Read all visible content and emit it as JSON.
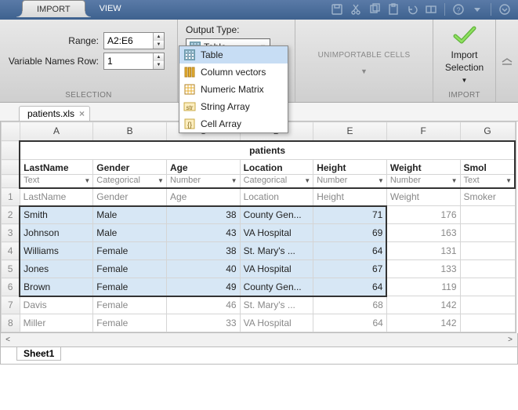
{
  "tabs": {
    "import": "IMPORT",
    "view": "VIEW"
  },
  "toolbar_icons": [
    "save",
    "cut",
    "copy",
    "paste",
    "undo",
    "redo",
    "help",
    "dropdown",
    "minimize"
  ],
  "selection": {
    "range_label": "Range:",
    "range_value": "A2:E6",
    "varnames_label": "Variable Names Row:",
    "varnames_value": "1",
    "group_label": "SELECTION"
  },
  "output": {
    "label": "Output Type:",
    "selected": "Table",
    "options": [
      {
        "label": "Table",
        "icon": "table-icon"
      },
      {
        "label": "Column vectors",
        "icon": "columns-icon"
      },
      {
        "label": "Numeric Matrix",
        "icon": "matrix-icon"
      },
      {
        "label": "String Array",
        "icon": "string-icon"
      },
      {
        "label": "Cell Array",
        "icon": "cell-icon"
      }
    ]
  },
  "unimportable": {
    "label": "UNIMPORTABLE CELLS"
  },
  "import": {
    "line1": "Import",
    "line2": "Selection",
    "group_label": "IMPORT"
  },
  "file": {
    "name": "patients.xls"
  },
  "columns": [
    "A",
    "B",
    "C",
    "D",
    "E",
    "F",
    "G"
  ],
  "table_name": "patients",
  "fields": [
    {
      "name": "LastName",
      "type": "Text"
    },
    {
      "name": "Gender",
      "type": "Categorical"
    },
    {
      "name": "Age",
      "type": "Number"
    },
    {
      "name": "Location",
      "type": "Categorical"
    },
    {
      "name": "Height",
      "type": "Number"
    },
    {
      "name": "Weight",
      "type": "Number"
    },
    {
      "name": "Smoker",
      "short": "Smol",
      "type": "Text"
    }
  ],
  "rows": [
    {
      "n": 1,
      "sel": false,
      "c": [
        "LastName",
        "Gender",
        "Age",
        "Location",
        "Height",
        "Weight",
        "Smoker"
      ]
    },
    {
      "n": 2,
      "sel": true,
      "c": [
        "Smith",
        "Male",
        "38",
        "County Gen...",
        "71",
        "176",
        ""
      ]
    },
    {
      "n": 3,
      "sel": true,
      "c": [
        "Johnson",
        "Male",
        "43",
        "VA Hospital",
        "69",
        "163",
        ""
      ]
    },
    {
      "n": 4,
      "sel": true,
      "c": [
        "Williams",
        "Female",
        "38",
        "St. Mary's ...",
        "64",
        "131",
        ""
      ]
    },
    {
      "n": 5,
      "sel": true,
      "c": [
        "Jones",
        "Female",
        "40",
        "VA Hospital",
        "67",
        "133",
        ""
      ]
    },
    {
      "n": 6,
      "sel": true,
      "c": [
        "Brown",
        "Female",
        "49",
        "County Gen...",
        "64",
        "119",
        ""
      ]
    },
    {
      "n": 7,
      "sel": false,
      "c": [
        "Davis",
        "Female",
        "46",
        "St. Mary's ...",
        "68",
        "142",
        ""
      ]
    },
    {
      "n": 8,
      "sel": false,
      "c": [
        "Miller",
        "Female",
        "33",
        "VA Hospital",
        "64",
        "142",
        ""
      ]
    }
  ],
  "numeric_cols": [
    2,
    4,
    5
  ],
  "sel_cols": [
    0,
    1,
    2,
    3,
    4
  ],
  "sheet_tab": "Sheet1"
}
